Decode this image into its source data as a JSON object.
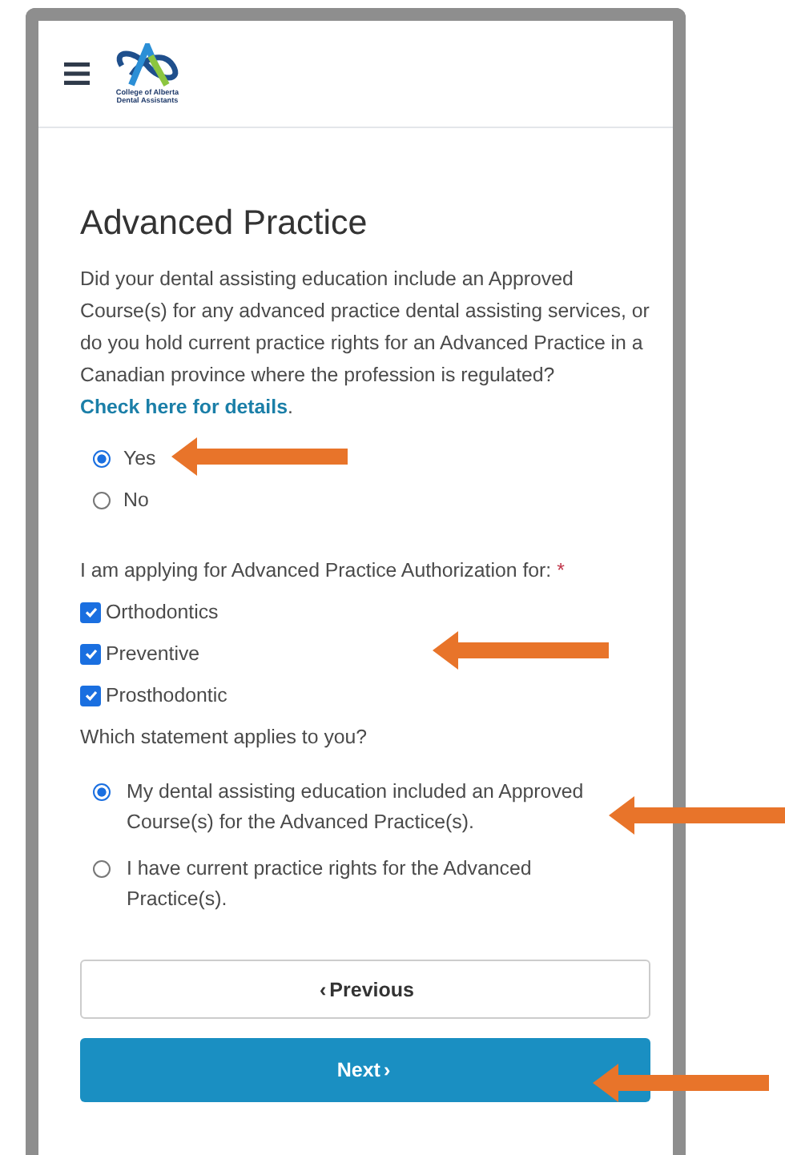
{
  "header": {
    "logo_text": [
      "College of Alberta",
      "Dental Assistants"
    ]
  },
  "title": "Advanced Practice",
  "question": {
    "text": "Did your dental assisting education include an Approved Course(s) for any advanced practice dental assisting services, or do you hold current practice rights for an Advanced Practice in a Canadian province where the profession is regulated?",
    "link": "Check here for details",
    "after": "."
  },
  "yes_no": [
    {
      "label": "Yes",
      "selected": true
    },
    {
      "label": "No",
      "selected": false
    }
  ],
  "authorization": {
    "label": "I am applying for Advanced Practice Authorization for:",
    "required_mark": "*",
    "options": [
      {
        "label": "Orthodontics",
        "checked": true
      },
      {
        "label": "Preventive",
        "checked": true
      },
      {
        "label": "Prosthodontic",
        "checked": true
      }
    ]
  },
  "statement": {
    "label": "Which statement applies to you?",
    "options": [
      {
        "label": "My dental assisting education included an Approved Course(s) for the Advanced Practice(s).",
        "selected": true
      },
      {
        "label": "I have current practice rights for the Advanced Practice(s).",
        "selected": false
      }
    ]
  },
  "buttons": [
    {
      "kind": "previous",
      "label": "Previous",
      "icon": "‹"
    },
    {
      "kind": "next",
      "label": "Next",
      "icon": "›"
    }
  ]
}
